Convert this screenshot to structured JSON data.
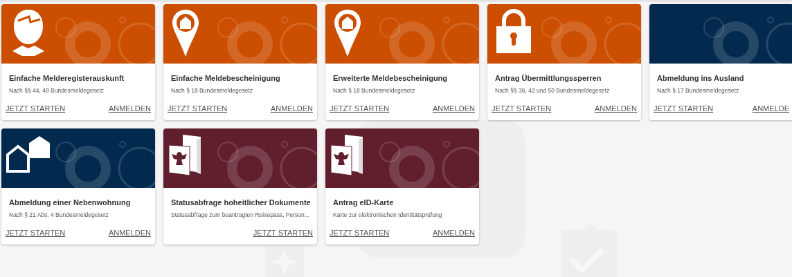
{
  "cards": [
    {
      "title": "Einfache Melderegisterauskunft",
      "subtitle": "Nach §§ 44, 49 Bundesmeldegesetz",
      "color": "#cc4e00",
      "kind": "person",
      "actions": [
        "JETZT STARTEN",
        "ANMELDEN"
      ]
    },
    {
      "title": "Einfache Meldebescheinigung",
      "subtitle": "Nach § 18 Bundesmeldegesetz",
      "color": "#cc4e00",
      "kind": "pin",
      "actions": [
        "JETZT STARTEN",
        "ANMELDEN"
      ]
    },
    {
      "title": "Erweiterte Meldebescheinigung",
      "subtitle": "Nach § 18 Bundesmeldegesetz",
      "color": "#cc4e00",
      "kind": "pin",
      "actions": [
        "JETZT STARTEN",
        "ANMELDEN"
      ]
    },
    {
      "title": "Antrag Übermittlungssperren",
      "subtitle": "Nach §§ 36, 42 und 50 Bundesmeldegesetz",
      "color": "#cc4e00",
      "kind": "lock",
      "actions": [
        "JETZT STARTEN",
        "ANMELDEN"
      ]
    },
    {
      "title": "Abmeldung ins Ausland",
      "subtitle": "Nach § 17 Bundesmeldegesetz",
      "color": "#012a4e",
      "kind": "plain",
      "actions": [
        "JETZT STARTEN",
        "ANMELDE"
      ]
    },
    {
      "title": "Abmeldung einer Nebenwohnung",
      "subtitle": "Nach § 21 Abs. 4 Bundesmeldegesetz",
      "color": "#012a4e",
      "kind": "houses",
      "actions": [
        "JETZT STARTEN",
        "ANMELDEN"
      ]
    },
    {
      "title": "Statusabfrage hoheitlicher Dokumente",
      "subtitle": "Statusabfrage zum beantragten Reisepass, Person...",
      "color": "#611f2e",
      "kind": "documents",
      "actions": [
        "JETZT STARTEN"
      ]
    },
    {
      "title": "Antrag eID-Karte",
      "subtitle": "Karte zur elektronischen Identitätsprüfung",
      "color": "#611f2e",
      "kind": "documents",
      "actions": [
        "JETZT STARTEN",
        "ANMELDEN"
      ]
    }
  ]
}
